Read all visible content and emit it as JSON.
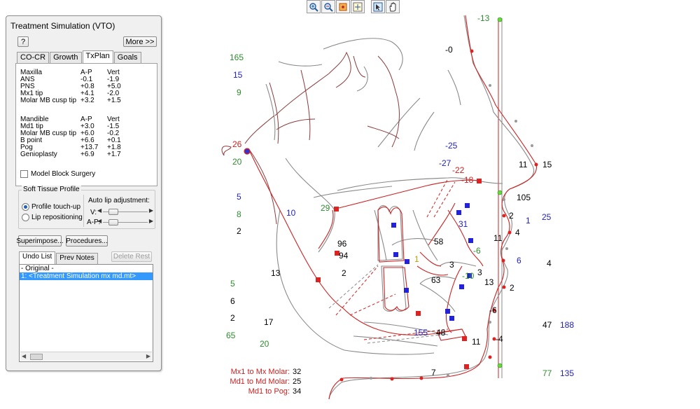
{
  "panel": {
    "title": "Treatment Simulation (VTO)",
    "help_label": "?",
    "more_label": "More >>",
    "tabs": [
      "CO-CR",
      "Growth",
      "TxPlan",
      "Goals"
    ],
    "active_tab": "TxPlan",
    "maxilla": {
      "header": [
        "Maxilla",
        "A-P",
        "Vert"
      ],
      "rows": [
        [
          "ANS",
          "-0.1",
          "-1.9"
        ],
        [
          "PNS",
          "+0.8",
          "+5.0"
        ],
        [
          "Mx1 tip",
          "+4.1",
          "-2.0"
        ],
        [
          "Molar MB cusp tip",
          "+3.2",
          "+1.5"
        ]
      ]
    },
    "mandible": {
      "header": [
        "Mandible",
        "A-P",
        "Vert"
      ],
      "rows": [
        [
          "Md1 tip",
          "+3.0",
          "-1.5"
        ],
        [
          "Molar MB cusp tip",
          "+6.0",
          "-0.2"
        ],
        [
          "B point",
          "+6.6",
          "+0.1"
        ],
        [
          "Pog",
          "+13.7",
          "+1.8"
        ],
        [
          "Genioplasty",
          "+6.9",
          "+1.7"
        ]
      ]
    },
    "model_block_label": "Model Block Surgery",
    "soft_tissue": {
      "group_label": "Soft Tissue Profile",
      "option1": "Profile touch-up",
      "option2": "Lip repositioning",
      "selected": "Profile touch-up",
      "auto_lip_label": "Auto lip adjustment:",
      "v_label": "V:",
      "ap_label": "A-P:"
    },
    "superimpose_label": "Superimpose...",
    "procedures_label": "Procedures...",
    "undo_tabs": [
      "Undo List",
      "Prev Notes"
    ],
    "delete_rest_label": "Delete Rest",
    "undo_items": [
      "- Original -",
      "1:  <Treatment Simulation mx md.mt>"
    ],
    "undo_selected_index": 1
  },
  "toolbar": {
    "icons": [
      "zoom-in-icon",
      "zoom-out-icon",
      "zoom-rect-icon",
      "fit-window-icon",
      "pointer-icon",
      "pan-hand-icon"
    ]
  },
  "canvas": {
    "colors": {
      "red": "#cc2222",
      "gray": "#8a8a8a",
      "green": "#2e8b2e",
      "blue": "#2222bb",
      "black": "#000000",
      "dark_red_lines": "#8b3a3a"
    },
    "labels": {
      "l165": "165",
      "l15": "15",
      "l9": "9",
      "l26": "26",
      "l20": "20",
      "l5a": "5",
      "l8": "8",
      "l2a": "2",
      "l10": "10",
      "l29": "29",
      "l96": "96",
      "l94": "94",
      "l2b": "2",
      "l13a": "13",
      "l5b": "5",
      "l6": "6",
      "l2c": "2",
      "l65": "65",
      "l17": "17",
      "l20b": "20",
      "lm13": "-13",
      "lm0": "-0",
      "lm25": "-25",
      "lm27": "-27",
      "lm22": "-22",
      "lm18": "-18",
      "l11a": "11",
      "l15b": "15",
      "l105": "105",
      "l25": "25",
      "l2d": "2",
      "l4a": "4",
      "l1": "1",
      "l31": "31",
      "l58": "58",
      "l11b": "11",
      "lm6": "-6",
      "l6b": "6",
      "l4b": "4",
      "l3a": "3",
      "l3b": "3",
      "l63": "63",
      "lm10": "-10",
      "l13b": "13",
      "l2e": "2",
      "lm6b": "-6",
      "l1b": "1",
      "l47": "47",
      "l188": "188",
      "l155": "155",
      "l48": "48",
      "l11c": "11",
      "lm4": "-4",
      "l7": "7",
      "l77": "77",
      "l135": "135"
    }
  },
  "bottom_metrics": [
    {
      "label": "Mx1 to Mx Molar:",
      "value": "32"
    },
    {
      "label": "Md1 to Md Molar:",
      "value": "25"
    },
    {
      "label": "Md1 to Pog:",
      "value": "34"
    }
  ]
}
